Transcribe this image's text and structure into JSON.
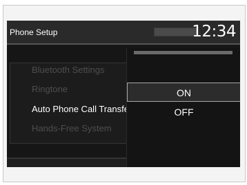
{
  "header": {
    "title": "Phone Setup",
    "clock": "12:34"
  },
  "menu": {
    "items": [
      {
        "label": "Bluetooth Settings",
        "state": "dim"
      },
      {
        "label": "Ringtone",
        "state": "dim"
      },
      {
        "label": "Auto Phone Call Transfer",
        "state": "active"
      },
      {
        "label": "Hands-Free System",
        "state": "dim"
      }
    ]
  },
  "popup": {
    "options": [
      {
        "label": "ON",
        "selected": true
      },
      {
        "label": "OFF",
        "selected": false
      }
    ]
  }
}
